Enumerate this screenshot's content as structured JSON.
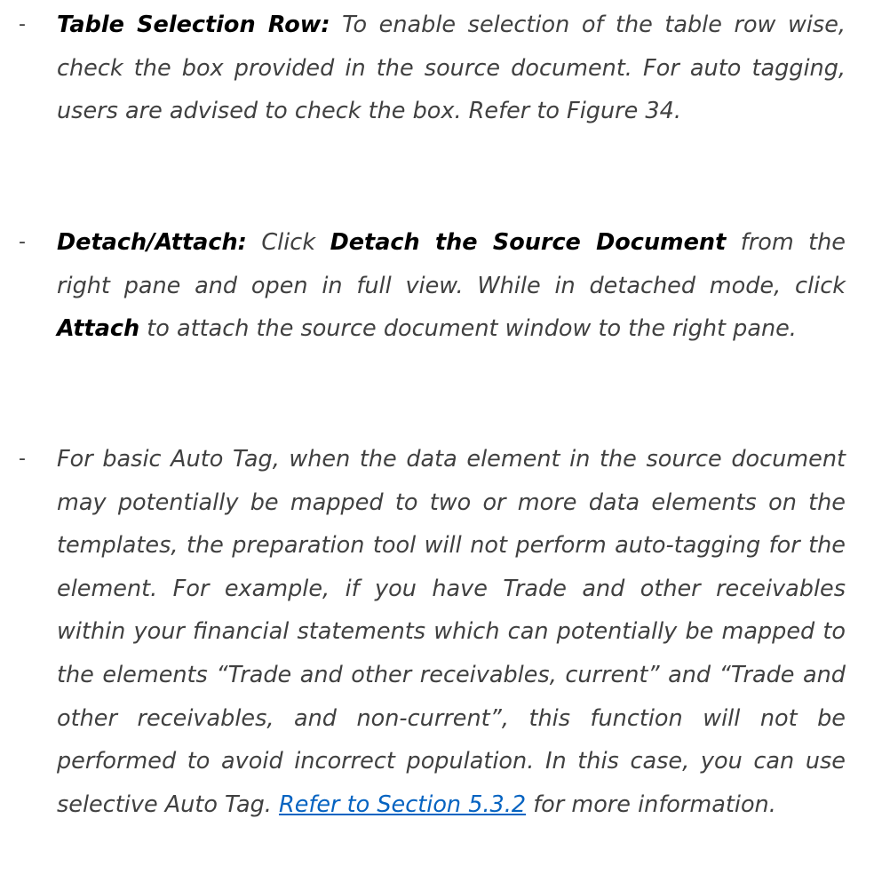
{
  "bullets": [
    {
      "marker": "-",
      "term": "Table Selection Row:",
      "text": " To enable selection of the table row wise, check the box provided in the source document. For auto tagging, users are advised to check the box. Refer to Figure 34."
    },
    {
      "marker": "-",
      "term": "Detach/Attach:",
      "text_a": " Click ",
      "bold_a": "Detach the Source Document",
      "text_b": " from the right pane and open in full view. While in detached mode, click ",
      "bold_b": "Attach",
      "text_c": " to attach the source document window to the right pane."
    },
    {
      "marker": "-",
      "text": "For basic Auto Tag, when the data element in the source document may potentially be mapped to two or more data elements on the templates, the preparation tool will not perform auto-tagging for the element. For example, if you have Trade and other receivables within your financial statements which can potentially be mapped to the elements “Trade and other receivables, current” and “Trade and other receivables, and non-current”, this function will not be performed to avoid incorrect population. In this case, you can use selective Auto Tag. ",
      "link": "Refer to Section 5.3.2",
      "text_after": " for more information."
    }
  ]
}
